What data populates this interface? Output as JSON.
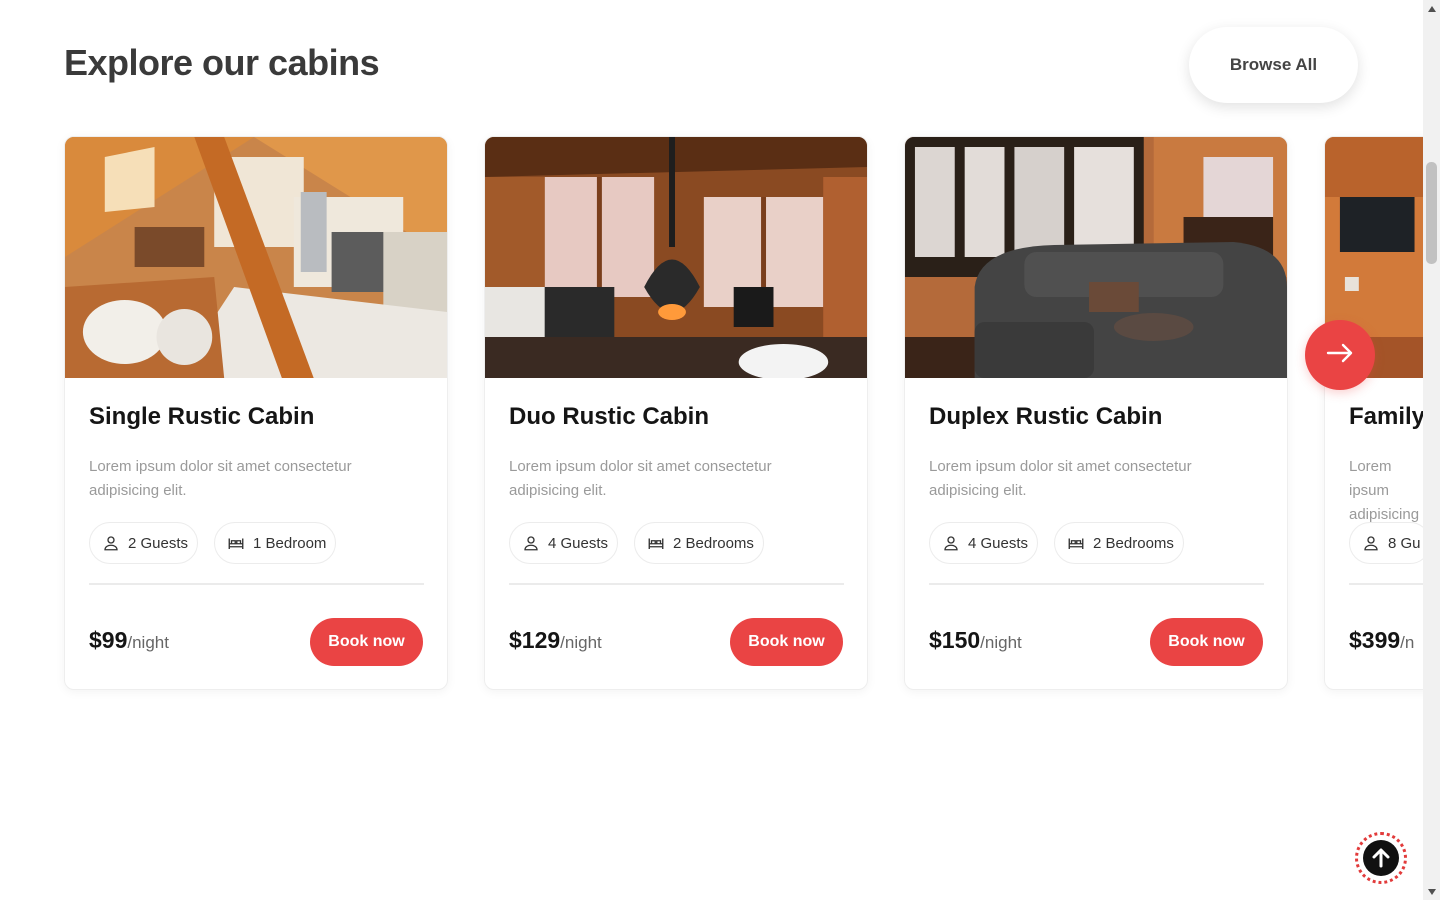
{
  "section": {
    "title": "Explore our cabins",
    "browse_label": "Browse All"
  },
  "cards": [
    {
      "title": "Single Rustic Cabin",
      "description": "Lorem ipsum dolor sit amet consectetur adipisicing elit.",
      "guests": "2 Guests",
      "bedrooms": "1 Bedroom",
      "price": "$99",
      "unit": "/night",
      "book_label": "Book now"
    },
    {
      "title": "Duo Rustic Cabin",
      "description": "Lorem ipsum dolor sit amet consectetur adipisicing elit.",
      "guests": "4 Guests",
      "bedrooms": "2 Bedrooms",
      "price": "$129",
      "unit": "/night",
      "book_label": "Book now"
    },
    {
      "title": "Duplex Rustic Cabin",
      "description": "Lorem ipsum dolor sit amet consectetur adipisicing elit.",
      "guests": "4 Guests",
      "bedrooms": "2 Bedrooms",
      "price": "$150",
      "unit": "/night",
      "book_label": "Book now"
    },
    {
      "title": "Family",
      "description": "Lorem ipsum adipisicing",
      "guests": "8 Gu",
      "price": "$399",
      "unit": "/n"
    }
  ],
  "icons": {
    "guests": "user-icon",
    "bedrooms": "bed-icon",
    "next": "arrow-right-icon",
    "scroll_top": "arrow-up-icon"
  },
  "colors": {
    "accent": "#ea4444",
    "title": "#3a3a3a",
    "muted": "#9a9a9a"
  }
}
